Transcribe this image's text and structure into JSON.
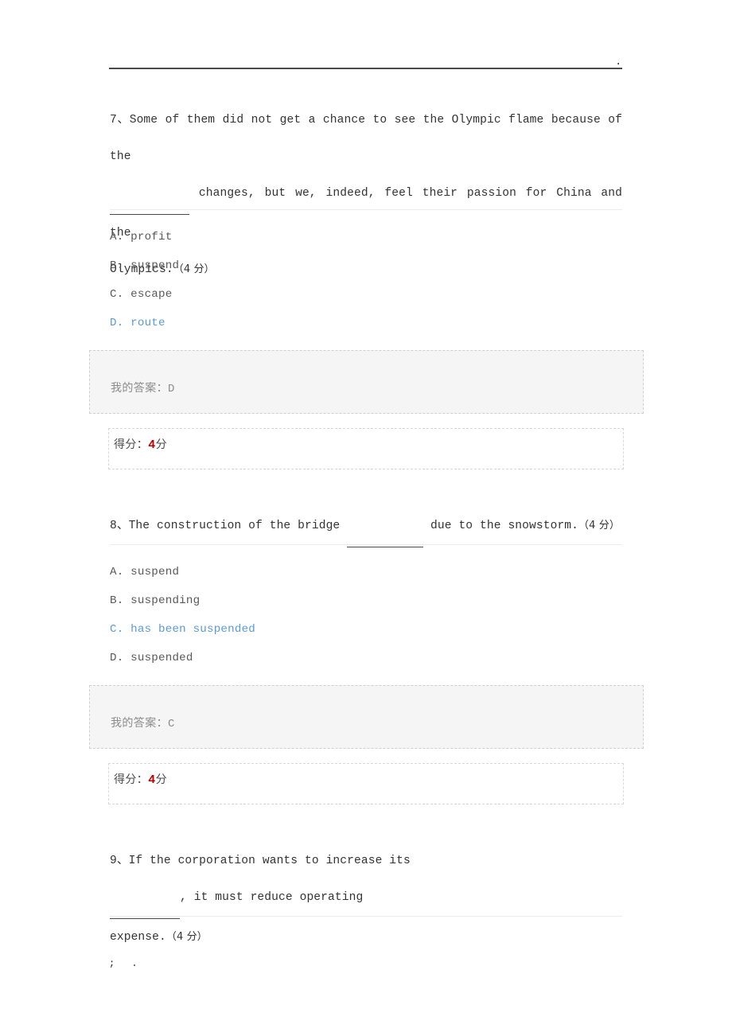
{
  "document": {
    "top_rule_trailing_mark": ".",
    "footer_marks": "; ."
  },
  "questions": [
    {
      "number": "7、",
      "text_line1": "Some of them did not get a chance to see the Olympic flame because of the",
      "text_line2_after_blank": "changes, but we, indeed, feel their passion for China and the",
      "text_line3": "Olympics.",
      "points_label": "（4 分）",
      "layout": "multiline",
      "options": [
        {
          "letter": "A.",
          "text": "profit",
          "selected": false
        },
        {
          "letter": "B.",
          "text": "suspend",
          "selected": false
        },
        {
          "letter": "C.",
          "text": "escape",
          "selected": false
        },
        {
          "letter": "D.",
          "text": "route",
          "selected": true
        }
      ],
      "my_answer_label": "我的答案：",
      "my_answer_value": "D",
      "score_label": "得分：",
      "score_value": "4",
      "score_unit": "分"
    },
    {
      "number": "8、",
      "text_before_blank": "The construction of the bridge",
      "text_after_blank": "due to the snowstorm.",
      "points_label": "（4 分）",
      "layout": "single",
      "options": [
        {
          "letter": "A.",
          "text": "suspend",
          "selected": false
        },
        {
          "letter": "B.",
          "text": "suspending",
          "selected": false
        },
        {
          "letter": "C.",
          "text": "has been suspended",
          "selected": true
        },
        {
          "letter": "D.",
          "text": "suspended",
          "selected": false
        }
      ],
      "my_answer_label": "我的答案：",
      "my_answer_value": "C",
      "score_label": "得分：",
      "score_value": "4",
      "score_unit": "分"
    },
    {
      "number": "9、",
      "text_before_blank": "If the corporation wants to increase its",
      "text_after_blank": ", it must reduce operating",
      "text_line2": "expense.",
      "points_label": "（4 分）",
      "layout": "multiline-truncated",
      "options": [],
      "my_answer_label": "",
      "my_answer_value": "",
      "score_label": "",
      "score_value": "",
      "score_unit": ""
    }
  ],
  "colors": {
    "selected_option_text": "#5b9bd5",
    "selected_option_background": "#f3f8fd",
    "score_number": "#c00000",
    "answer_box_background": "#f5f5f5",
    "body_text": "#333333",
    "option_text": "#595959"
  }
}
